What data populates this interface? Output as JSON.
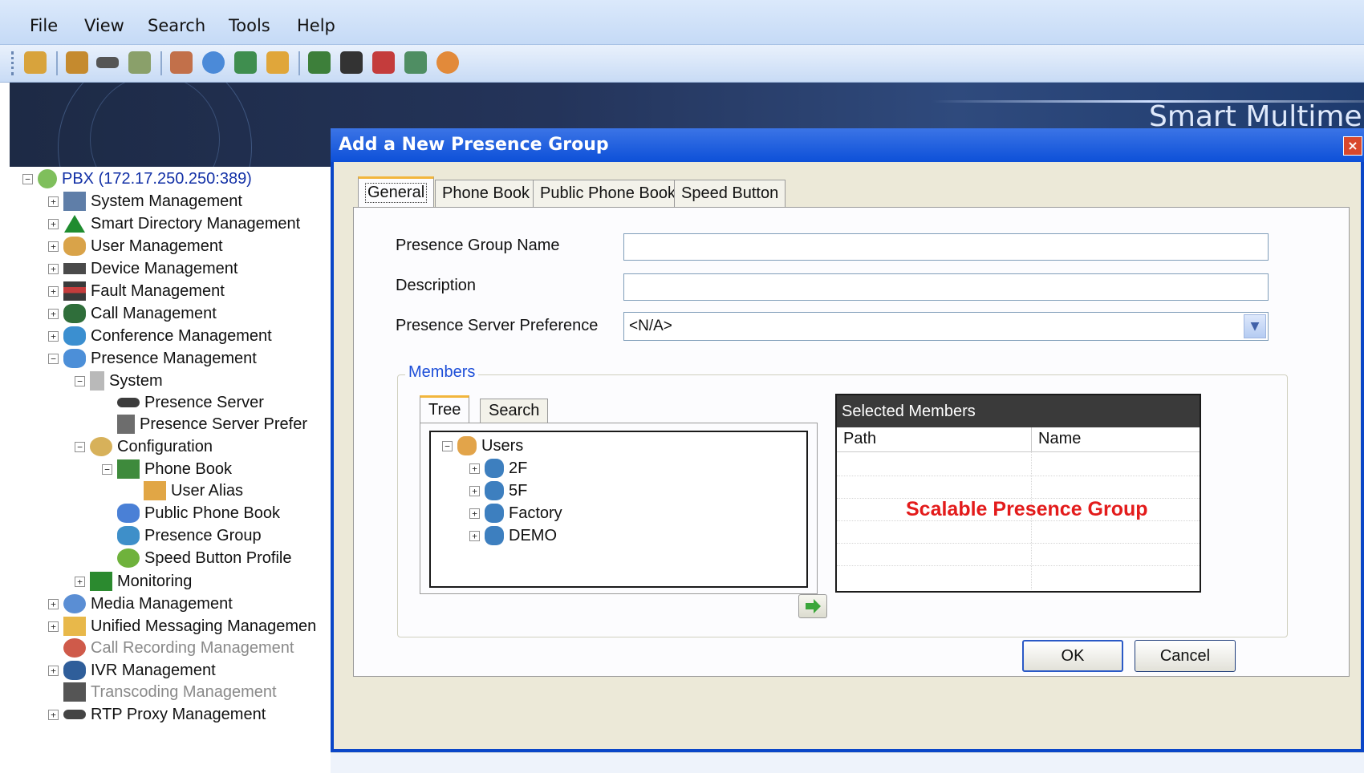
{
  "menu": [
    "File",
    "View",
    "Search",
    "Tools",
    "Help"
  ],
  "toolbar_icons": [
    "users-icon",
    "group-icon",
    "device-icon",
    "call-icon",
    "fault-icon",
    "globe-icon",
    "conference-icon",
    "presence-icon",
    "report-icon",
    "document-icon",
    "alarm-icon",
    "phone-book-icon",
    "shield-icon"
  ],
  "banner": {
    "title": "Smart Multime"
  },
  "tree": {
    "root": "PBX (172.17.250.250:389)",
    "items": [
      "System Management",
      "Smart Directory Management",
      "User Management",
      "Device Management",
      "Fault Management",
      "Call Management",
      "Conference Management",
      "Presence Management",
      "System",
      "Presence Server",
      "Presence Server Prefer",
      "Configuration",
      "Phone Book",
      "User Alias",
      "Public Phone Book",
      "Presence Group",
      "Speed Button Profile",
      "Monitoring",
      "Media Management",
      "Unified Messaging Managemen",
      "Call Recording Management",
      "IVR Management",
      "Transcoding Management",
      "RTP Proxy Management"
    ]
  },
  "dialog": {
    "title": "Add a New Presence Group",
    "close": "×",
    "tabs": [
      "General",
      "Phone Book",
      "Public Phone Book",
      "Speed Button"
    ],
    "fields": {
      "name_label": "Presence Group Name",
      "name_value": "",
      "description_label": "Description",
      "description_value": "",
      "server_pref_label": "Presence Server Preference",
      "server_pref_value": "<N/A>"
    },
    "members": {
      "legend": "Members",
      "subtabs": [
        "Tree",
        "Search"
      ],
      "tree_root": "Users",
      "tree_children": [
        "2F",
        "5F",
        "Factory",
        "DEMO"
      ],
      "selected_title": "Selected Members",
      "columns": [
        "Path",
        "Name"
      ],
      "overlay": "Scalable Presence Group"
    },
    "ok": "OK",
    "cancel": "Cancel"
  },
  "colors": {
    "title_bar": "#0d50d8",
    "overlay_text": "#e31b1b",
    "tab_accent": "#f2b63c"
  }
}
